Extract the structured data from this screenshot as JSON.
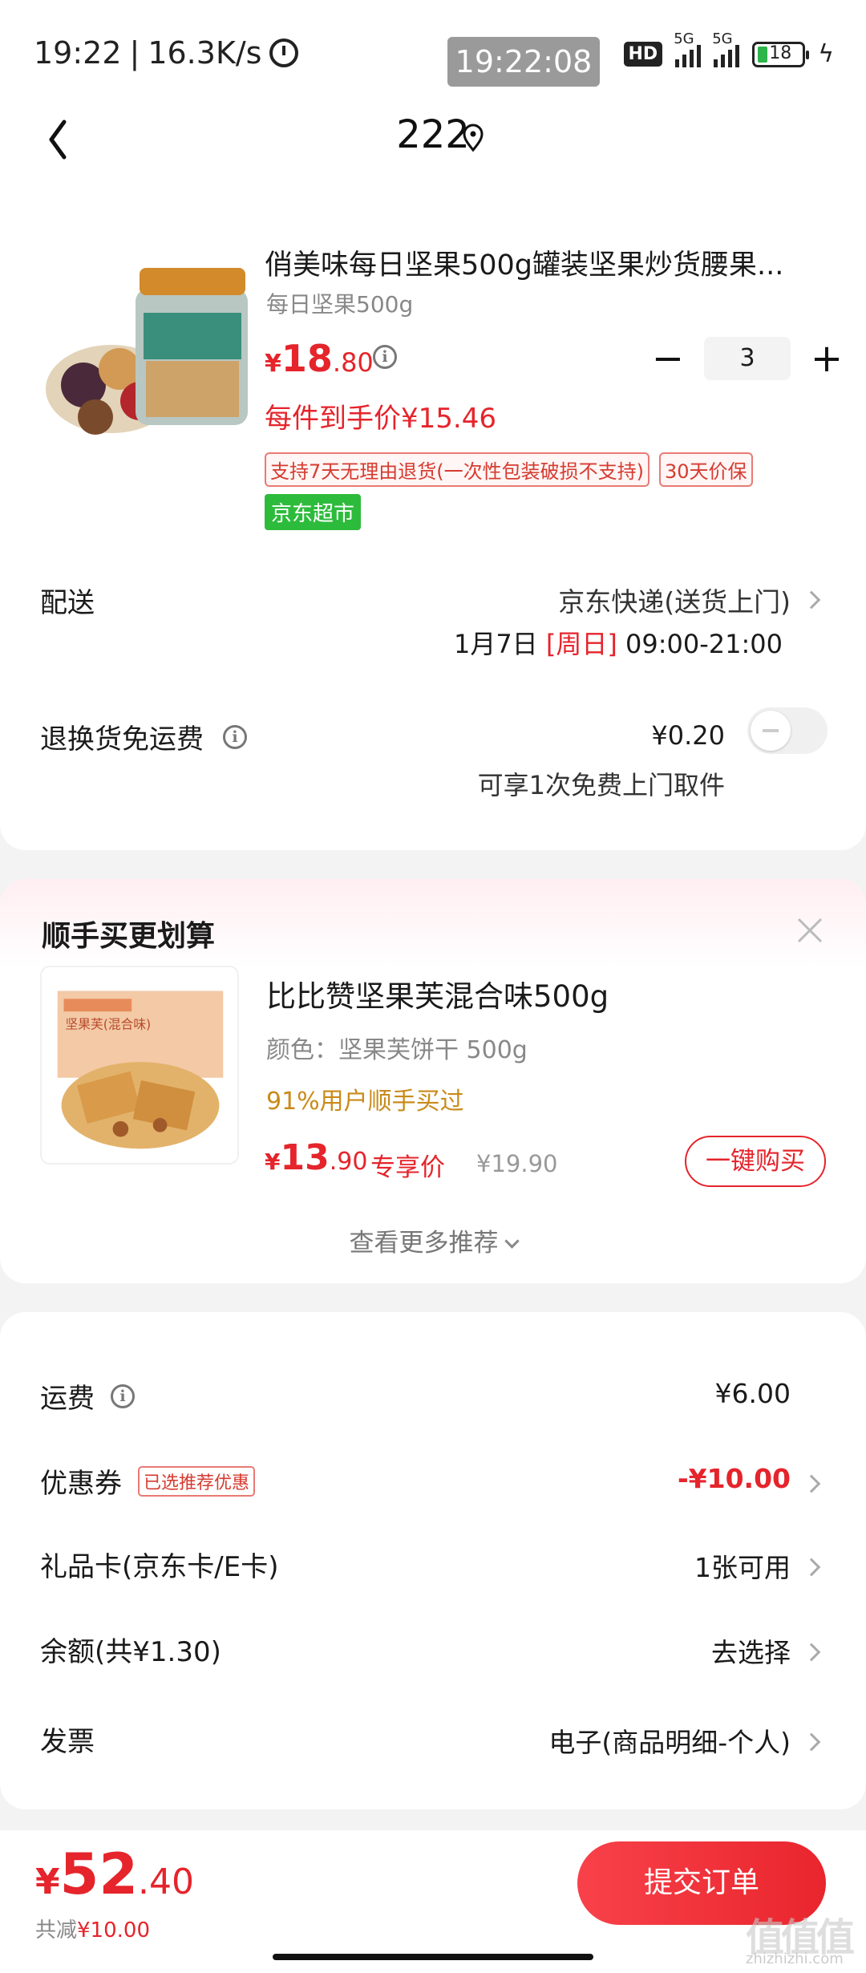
{
  "status_bar": {
    "time": "19:22",
    "speed": "16.3K/s",
    "clock_overlay": "19:22:08",
    "hd_label": "HD",
    "signal1_label": "5G",
    "signal2_label": "5G",
    "battery": "18"
  },
  "header": {
    "title": "222"
  },
  "product": {
    "title": "俏美味每日坚果500g罐装坚果炒货腰果...",
    "spec": "每日坚果500g",
    "price_symbol": "¥",
    "price_int": "18",
    "price_dec": ".80",
    "quantity": "3",
    "unit_price": "每件到手价¥15.46",
    "tag_return": "支持7天无理由退货(一次性包装破损不支持)",
    "tag_price_protect": "30天价保",
    "tag_store": "京东超市"
  },
  "delivery": {
    "label": "配送",
    "method": "京东快递(送货上门)",
    "date": "1月7日",
    "weekday": "[周日]",
    "time_range": "09:00-21:00"
  },
  "return_shipping": {
    "label": "退换货免运费",
    "price": "¥0.20",
    "note": "可享1次免费上门取件"
  },
  "recommend": {
    "title": "顺手买更划算",
    "name": "比比赞坚果芙混合味500g",
    "spec": "颜色：坚果芙饼干 500g",
    "social": "91%用户顺手买过",
    "price_symbol": "¥",
    "price_int": "13",
    "price_dec": ".90",
    "price_label": "专享价",
    "original_price": "¥19.90",
    "buy_button": "一键购买",
    "more": "查看更多推荐",
    "img_box_label": "坚果芙(混合味)"
  },
  "fees": {
    "shipping_label": "运费",
    "shipping_value": "¥6.00",
    "coupon_label": "优惠券",
    "coupon_tag": "已选推荐优惠",
    "coupon_value": "-¥10.00",
    "giftcard_label": "礼品卡(京东卡/E卡)",
    "giftcard_value": "1张可用",
    "balance_label": "余额(共¥1.30)",
    "balance_value": "去选择",
    "invoice_label": "发票",
    "invoice_value": "电子(商品明细-个人)"
  },
  "bottom": {
    "total_symbol": "¥",
    "total_int": "52",
    "total_dec": ".40",
    "saved_label": "共减",
    "saved_value": "¥10.00",
    "submit": "提交订单",
    "watermark": "值值值",
    "watermark_sub": "zhizhizhi.com"
  },
  "colors": {
    "accent_red": "#e5242b",
    "green_tag": "#2dbb3c",
    "social_gold": "#c98a1a"
  }
}
